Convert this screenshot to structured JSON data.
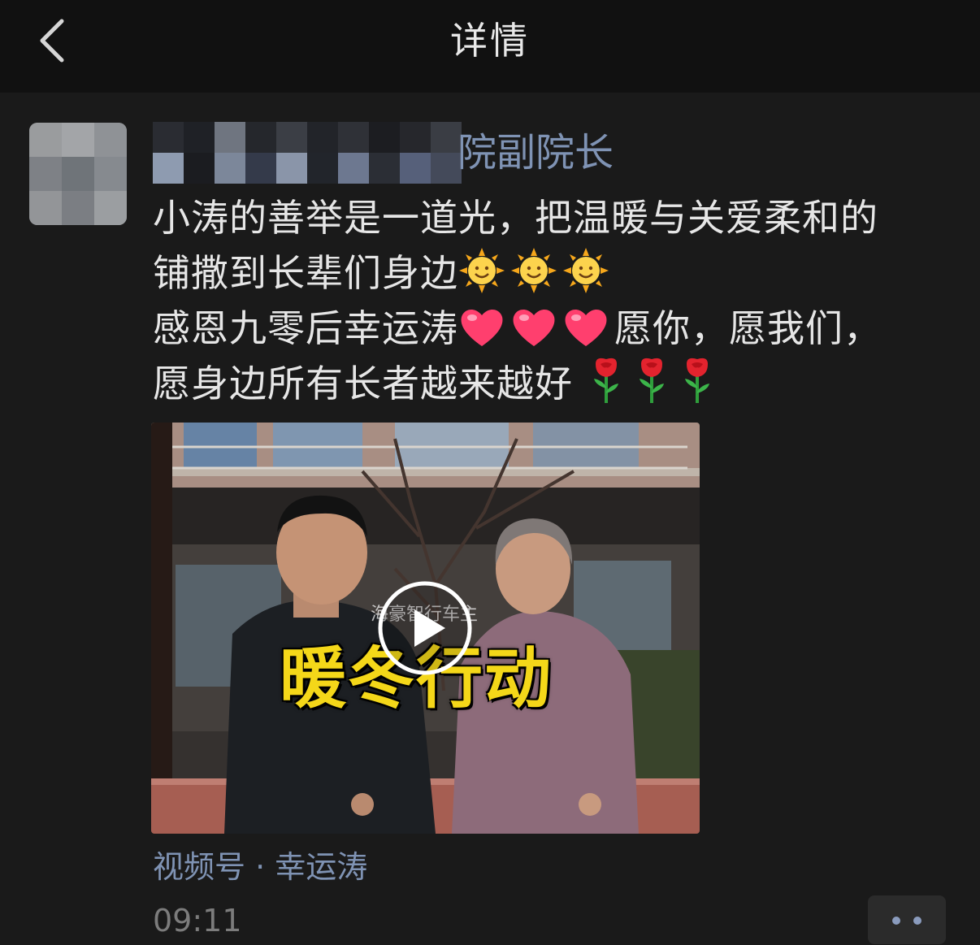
{
  "header": {
    "title": "详情",
    "back_icon": "chevron-left-icon"
  },
  "post": {
    "author_visible_suffix": "院副院长",
    "lines": [
      "小涛的善举是一道光，把温暖与关爱柔和的",
      "铺撒到长辈们身边",
      "感恩九零后幸运涛",
      "愿你，愿我们，",
      "愿身边所有长者越来越好"
    ],
    "emoji": {
      "sun": "sun-face-icon",
      "heart": "heart-icon",
      "rose": "rose-icon"
    },
    "video": {
      "overlay_title": "暖冬行动",
      "watermark": "海豪智行车主",
      "play_icon": "play-icon"
    },
    "channel": "视频号 · 幸运涛",
    "time": "09:11",
    "more_icon": "more-dots-icon"
  },
  "colors": {
    "background": "#1a1a1a",
    "topbar": "#111111",
    "link": "#7f93b4",
    "text": "#e6e6e6",
    "time": "#7c7c7c",
    "overlay_title": "#f4d719"
  }
}
